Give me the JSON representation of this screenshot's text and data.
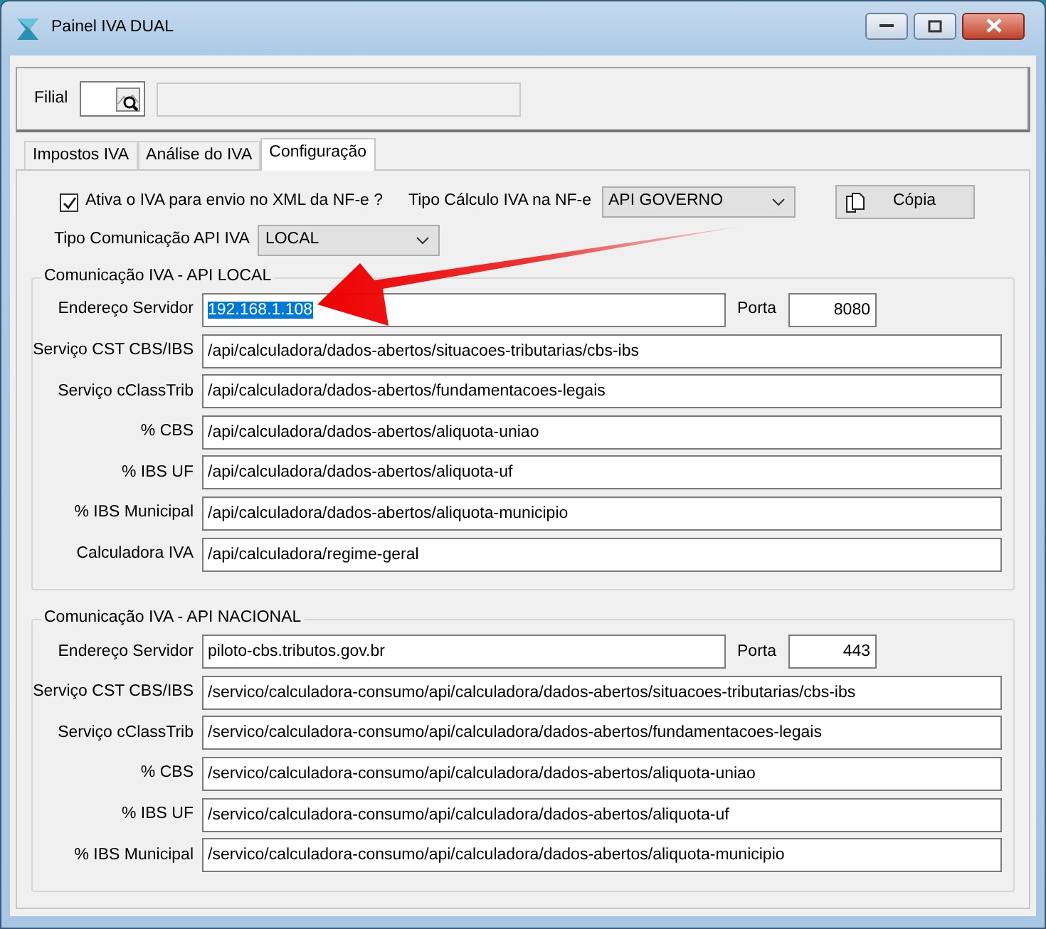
{
  "window": {
    "title": "Painel IVA DUAL"
  },
  "filial": {
    "label": "Filial"
  },
  "tabs": [
    {
      "label": "Impostos IVA",
      "selected": false
    },
    {
      "label": "Análise do IVA",
      "selected": false
    },
    {
      "label": "Configuração",
      "selected": true
    }
  ],
  "config": {
    "active_checkbox": {
      "label": "Ativa o IVA para envio no XML da NF-e ?",
      "checked": true
    },
    "calc_type": {
      "label": "Tipo Cálculo IVA na NF-e",
      "value": "API GOVERNO"
    },
    "copy_button": {
      "label": "Cópia"
    },
    "comm_type": {
      "label": "Tipo Comunicação API IVA",
      "value": "LOCAL"
    }
  },
  "groups": [
    {
      "title": "Comunicação IVA - API LOCAL",
      "server": {
        "label": "Endereço Servidor",
        "value": "192.168.1.108",
        "text_selected": true
      },
      "port": {
        "label": "Porta",
        "value": "8080"
      },
      "services": [
        {
          "label": "Serviço CST CBS/IBS",
          "value": "/api/calculadora/dados-abertos/situacoes-tributarias/cbs-ibs"
        },
        {
          "label": "Serviço cClassTrib",
          "value": "/api/calculadora/dados-abertos/fundamentacoes-legais"
        },
        {
          "label": "% CBS",
          "value": "/api/calculadora/dados-abertos/aliquota-uniao"
        },
        {
          "label": "% IBS UF",
          "value": "/api/calculadora/dados-abertos/aliquota-uf"
        },
        {
          "label": "% IBS Municipal",
          "value": "/api/calculadora/dados-abertos/aliquota-municipio"
        },
        {
          "label": "Calculadora IVA",
          "value": "/api/calculadora/regime-geral"
        }
      ]
    },
    {
      "title": "Comunicação IVA - API NACIONAL",
      "server": {
        "label": "Endereço Servidor",
        "value": "piloto-cbs.tributos.gov.br",
        "text_selected": false
      },
      "port": {
        "label": "Porta",
        "value": "443"
      },
      "services": [
        {
          "label": "Serviço CST CBS/IBS",
          "value": "/servico/calculadora-consumo/api/calculadora/dados-abertos/situacoes-tributarias/cbs-ibs"
        },
        {
          "label": "Serviço cClassTrib",
          "value": "/servico/calculadora-consumo/api/calculadora/dados-abertos/fundamentacoes-legais"
        },
        {
          "label": "% CBS",
          "value": "/servico/calculadora-consumo/api/calculadora/dados-abertos/aliquota-uniao"
        },
        {
          "label": "% IBS UF",
          "value": "/servico/calculadora-consumo/api/calculadora/dados-abertos/aliquota-uf"
        },
        {
          "label": "% IBS Municipal",
          "value": "/servico/calculadora-consumo/api/calculadora/dados-abertos/aliquota-municipio"
        }
      ]
    }
  ]
}
